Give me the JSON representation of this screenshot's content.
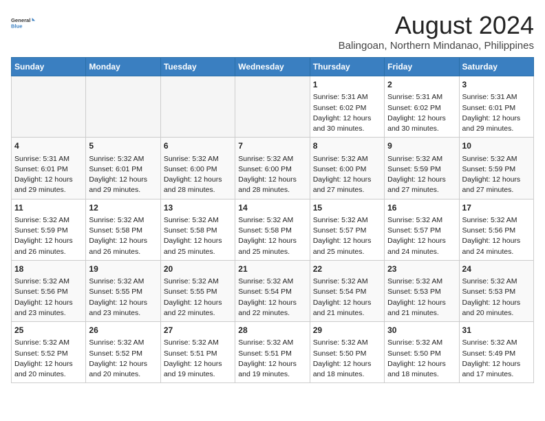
{
  "header": {
    "logo_line1": "General",
    "logo_line2": "Blue",
    "main_title": "August 2024",
    "subtitle": "Balingoan, Northern Mindanao, Philippines"
  },
  "calendar": {
    "days_of_week": [
      "Sunday",
      "Monday",
      "Tuesday",
      "Wednesday",
      "Thursday",
      "Friday",
      "Saturday"
    ],
    "weeks": [
      [
        {
          "day": "",
          "info": "",
          "empty": true
        },
        {
          "day": "",
          "info": "",
          "empty": true
        },
        {
          "day": "",
          "info": "",
          "empty": true
        },
        {
          "day": "",
          "info": "",
          "empty": true
        },
        {
          "day": "1",
          "info": "Sunrise: 5:31 AM\nSunset: 6:02 PM\nDaylight: 12 hours\nand 30 minutes."
        },
        {
          "day": "2",
          "info": "Sunrise: 5:31 AM\nSunset: 6:02 PM\nDaylight: 12 hours\nand 30 minutes."
        },
        {
          "day": "3",
          "info": "Sunrise: 5:31 AM\nSunset: 6:01 PM\nDaylight: 12 hours\nand 29 minutes."
        }
      ],
      [
        {
          "day": "4",
          "info": "Sunrise: 5:31 AM\nSunset: 6:01 PM\nDaylight: 12 hours\nand 29 minutes."
        },
        {
          "day": "5",
          "info": "Sunrise: 5:32 AM\nSunset: 6:01 PM\nDaylight: 12 hours\nand 29 minutes."
        },
        {
          "day": "6",
          "info": "Sunrise: 5:32 AM\nSunset: 6:00 PM\nDaylight: 12 hours\nand 28 minutes."
        },
        {
          "day": "7",
          "info": "Sunrise: 5:32 AM\nSunset: 6:00 PM\nDaylight: 12 hours\nand 28 minutes."
        },
        {
          "day": "8",
          "info": "Sunrise: 5:32 AM\nSunset: 6:00 PM\nDaylight: 12 hours\nand 27 minutes."
        },
        {
          "day": "9",
          "info": "Sunrise: 5:32 AM\nSunset: 5:59 PM\nDaylight: 12 hours\nand 27 minutes."
        },
        {
          "day": "10",
          "info": "Sunrise: 5:32 AM\nSunset: 5:59 PM\nDaylight: 12 hours\nand 27 minutes."
        }
      ],
      [
        {
          "day": "11",
          "info": "Sunrise: 5:32 AM\nSunset: 5:59 PM\nDaylight: 12 hours\nand 26 minutes."
        },
        {
          "day": "12",
          "info": "Sunrise: 5:32 AM\nSunset: 5:58 PM\nDaylight: 12 hours\nand 26 minutes."
        },
        {
          "day": "13",
          "info": "Sunrise: 5:32 AM\nSunset: 5:58 PM\nDaylight: 12 hours\nand 25 minutes."
        },
        {
          "day": "14",
          "info": "Sunrise: 5:32 AM\nSunset: 5:58 PM\nDaylight: 12 hours\nand 25 minutes."
        },
        {
          "day": "15",
          "info": "Sunrise: 5:32 AM\nSunset: 5:57 PM\nDaylight: 12 hours\nand 25 minutes."
        },
        {
          "day": "16",
          "info": "Sunrise: 5:32 AM\nSunset: 5:57 PM\nDaylight: 12 hours\nand 24 minutes."
        },
        {
          "day": "17",
          "info": "Sunrise: 5:32 AM\nSunset: 5:56 PM\nDaylight: 12 hours\nand 24 minutes."
        }
      ],
      [
        {
          "day": "18",
          "info": "Sunrise: 5:32 AM\nSunset: 5:56 PM\nDaylight: 12 hours\nand 23 minutes."
        },
        {
          "day": "19",
          "info": "Sunrise: 5:32 AM\nSunset: 5:55 PM\nDaylight: 12 hours\nand 23 minutes."
        },
        {
          "day": "20",
          "info": "Sunrise: 5:32 AM\nSunset: 5:55 PM\nDaylight: 12 hours\nand 22 minutes."
        },
        {
          "day": "21",
          "info": "Sunrise: 5:32 AM\nSunset: 5:54 PM\nDaylight: 12 hours\nand 22 minutes."
        },
        {
          "day": "22",
          "info": "Sunrise: 5:32 AM\nSunset: 5:54 PM\nDaylight: 12 hours\nand 21 minutes."
        },
        {
          "day": "23",
          "info": "Sunrise: 5:32 AM\nSunset: 5:53 PM\nDaylight: 12 hours\nand 21 minutes."
        },
        {
          "day": "24",
          "info": "Sunrise: 5:32 AM\nSunset: 5:53 PM\nDaylight: 12 hours\nand 20 minutes."
        }
      ],
      [
        {
          "day": "25",
          "info": "Sunrise: 5:32 AM\nSunset: 5:52 PM\nDaylight: 12 hours\nand 20 minutes."
        },
        {
          "day": "26",
          "info": "Sunrise: 5:32 AM\nSunset: 5:52 PM\nDaylight: 12 hours\nand 20 minutes."
        },
        {
          "day": "27",
          "info": "Sunrise: 5:32 AM\nSunset: 5:51 PM\nDaylight: 12 hours\nand 19 minutes."
        },
        {
          "day": "28",
          "info": "Sunrise: 5:32 AM\nSunset: 5:51 PM\nDaylight: 12 hours\nand 19 minutes."
        },
        {
          "day": "29",
          "info": "Sunrise: 5:32 AM\nSunset: 5:50 PM\nDaylight: 12 hours\nand 18 minutes."
        },
        {
          "day": "30",
          "info": "Sunrise: 5:32 AM\nSunset: 5:50 PM\nDaylight: 12 hours\nand 18 minutes."
        },
        {
          "day": "31",
          "info": "Sunrise: 5:32 AM\nSunset: 5:49 PM\nDaylight: 12 hours\nand 17 minutes."
        }
      ]
    ]
  }
}
